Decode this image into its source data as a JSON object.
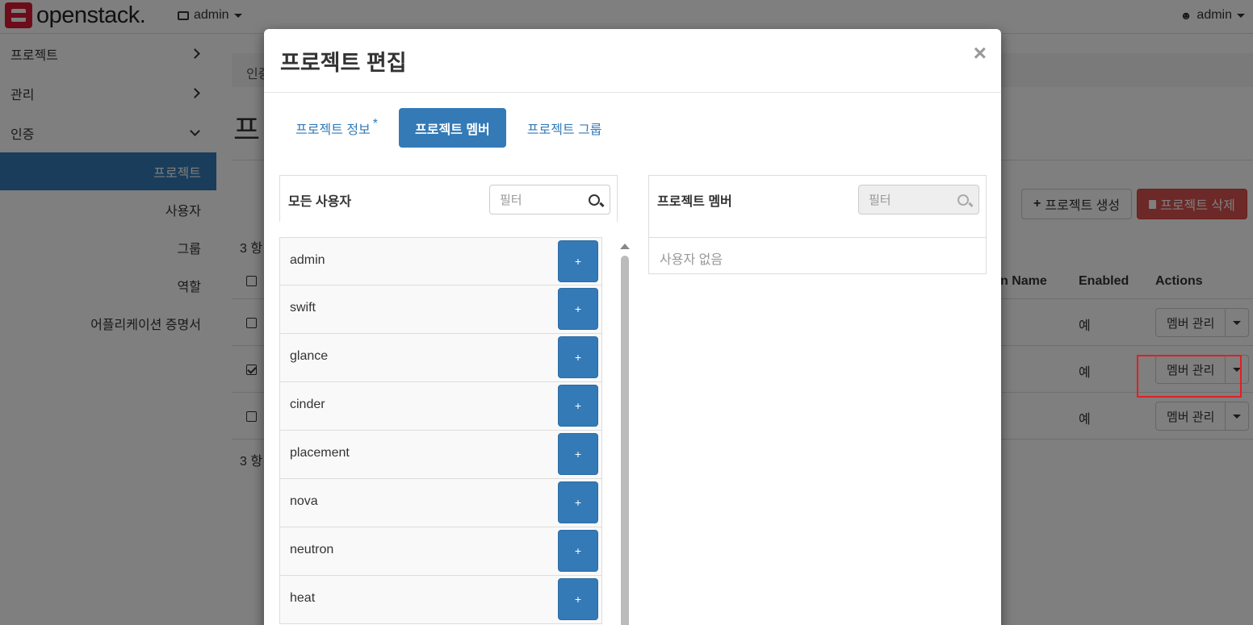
{
  "topbar": {
    "brand": "openstack.",
    "project_select": "admin",
    "user_menu": "admin"
  },
  "sidebar": {
    "items": [
      {
        "label": "프로젝트"
      },
      {
        "label": "관리"
      },
      {
        "label": "인증"
      }
    ],
    "subitems": [
      {
        "label": "프로젝트",
        "active": true
      },
      {
        "label": "사용자"
      },
      {
        "label": "그룹"
      },
      {
        "label": "역할"
      },
      {
        "label": "어플리케이션 증명서"
      }
    ]
  },
  "main": {
    "breadcrumb": "인증",
    "page_title": "프",
    "count_top": "3 항",
    "count_bottom": "3 항",
    "buttons": {
      "create": "프로젝트 생성",
      "delete": "프로젝트 삭제"
    },
    "columns": [
      "n Name",
      "Enabled",
      "Actions"
    ],
    "rows": [
      {
        "enabled": "예",
        "action": "멤버 관리",
        "checked": false
      },
      {
        "enabled": "예",
        "action": "멤버 관리",
        "checked": true
      },
      {
        "enabled": "예",
        "action": "멤버 관리",
        "checked": false
      }
    ]
  },
  "modal": {
    "title": "프로젝트 편집",
    "close": "×",
    "tabs": [
      {
        "label": "프로젝트 정보",
        "required": "*"
      },
      {
        "label": "프로젝트 멤버",
        "active": true
      },
      {
        "label": "프로젝트 그룹"
      }
    ],
    "all_users": {
      "title": "모든 사용자",
      "filter_placeholder": "필터",
      "users": [
        "admin",
        "swift",
        "glance",
        "cinder",
        "placement",
        "nova",
        "neutron",
        "heat"
      ],
      "add_label": "+"
    },
    "members": {
      "title": "프로젝트 멤버",
      "filter_placeholder": "필터",
      "empty": "사용자 없음"
    }
  }
}
